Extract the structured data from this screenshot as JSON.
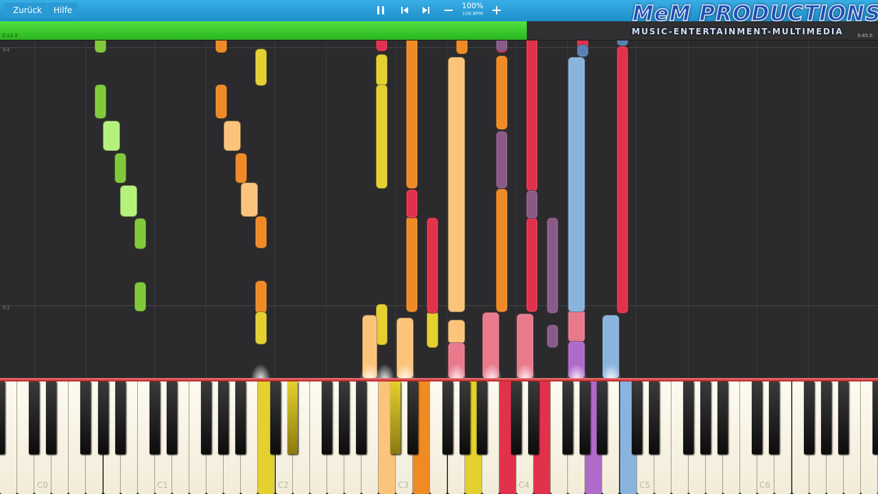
{
  "topbar": {
    "back_label": "Zurück",
    "help_label": "Hilfe",
    "speed_percent": "100%",
    "speed_bpm": "108 BPM",
    "controls": {
      "pause": "pause-icon",
      "prev": "skip-back-icon",
      "next": "skip-forward-icon",
      "minus": "minus-icon",
      "plus": "plus-icon"
    }
  },
  "logo": {
    "main": "MeM PRODUCTIONS",
    "sub": "MUSIC-ENTERTAINMENT-MULTIMEDIA"
  },
  "progress": {
    "fraction": 0.6,
    "elapsed": "2:13.3",
    "total": "3:45.0",
    "fill_color": "#3dcb2d"
  },
  "roll": {
    "measure_labels": [
      "64",
      "63"
    ]
  },
  "keyboard": {
    "octave_labels": [
      "C0",
      "C1",
      "C2",
      "C3",
      "C4",
      "C5",
      "C6"
    ]
  },
  "colors": {
    "green": "#7fc93a",
    "light_green": "#b4f27c",
    "orange": "#f08a24",
    "light_orange": "#fbc47a",
    "yellow": "#e4d02e",
    "red": "#e2314b",
    "pink": "#e87a8c",
    "purple": "#8a5a86",
    "violet": "#b06ac9",
    "blue": "#8ab4de"
  }
}
